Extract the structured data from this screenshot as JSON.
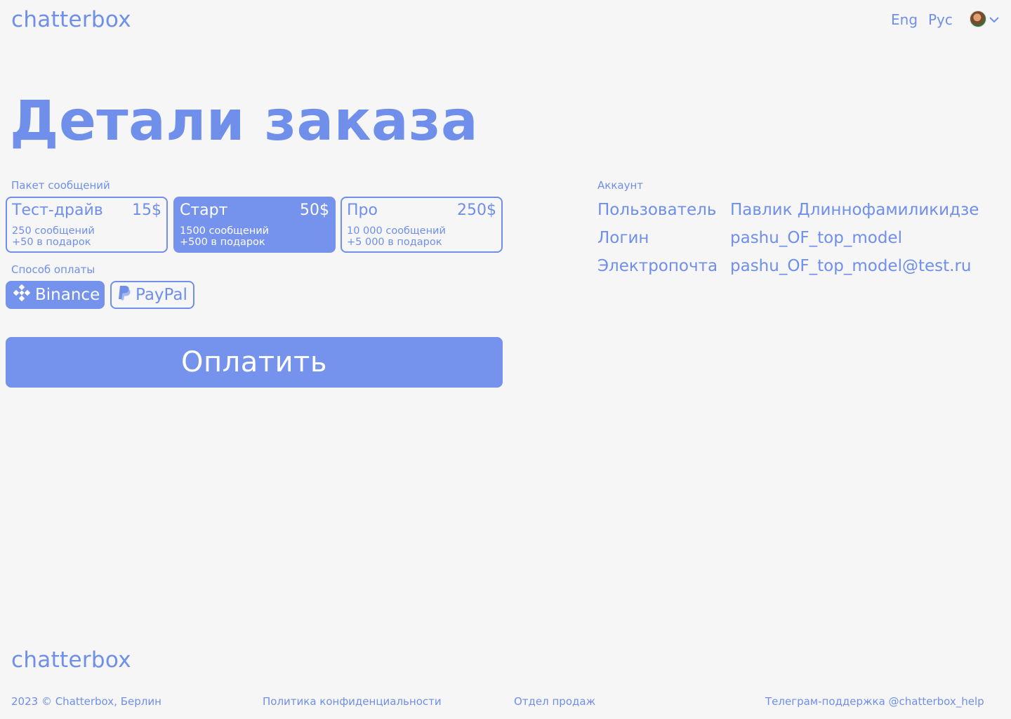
{
  "header": {
    "logo": "chatterbox",
    "lang_en": "Eng",
    "lang_ru": "Рус"
  },
  "main": {
    "title": "Детали заказа",
    "packages_label": "Пакет сообщений",
    "packages": [
      {
        "name": "Тест-драйв",
        "price": "15$",
        "messages": "250 сообщений",
        "bonus": "+50 в подарок",
        "selected": false
      },
      {
        "name": "Старт",
        "price": "50$",
        "messages": "1500 сообщений",
        "bonus": "+500 в подарок",
        "selected": true
      },
      {
        "name": "Про",
        "price": "250$",
        "messages": "10 000 сообщений",
        "bonus": "+5 000 в подарок",
        "selected": false
      }
    ],
    "payment_label": "Способ оплаты",
    "payment_methods": [
      {
        "label": "Binance",
        "icon": "binance-icon",
        "selected": true
      },
      {
        "label": "PayPal",
        "icon": "paypal-icon",
        "selected": false
      }
    ],
    "submit_label": "Оплатить"
  },
  "account": {
    "label": "Аккаунт",
    "user_key": "Пользователь",
    "user_value": "Павлик Длиннофамиликидзе",
    "login_key": "Логин",
    "login_value": "pashu_OF_top_model",
    "email_key": "Электропочта",
    "email_value": "pashu_OF_top_model@test.ru"
  },
  "footer": {
    "logo": "chatterbox",
    "copyright": "2023 © Chatterbox, Берлин",
    "privacy": "Политика конфиденциальности",
    "sales": "Отдел продаж",
    "support": "Телеграм-поддержка @chatterbox_help"
  },
  "colors": {
    "accent": "#7592ec",
    "background": "#f6f6f6"
  }
}
